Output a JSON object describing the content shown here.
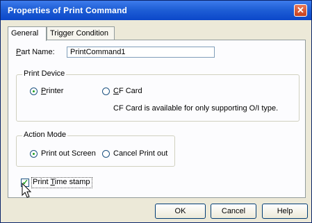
{
  "window": {
    "title": "Properties of Print Command",
    "close_glyph": "✕"
  },
  "tabs": [
    {
      "label": "General",
      "active": true
    },
    {
      "label": "Trigger Condition",
      "active": false
    }
  ],
  "part_name": {
    "label_first": "P",
    "label_rest": "art Name:",
    "value": "PrintCommand1"
  },
  "print_device": {
    "legend": "Print Device",
    "printer": {
      "label_first": "P",
      "label_rest": "rinter",
      "selected": true
    },
    "cf_card": {
      "label_first": "C",
      "label_rest": "F Card",
      "selected": false
    },
    "note": "CF Card is available for only supporting O/I type."
  },
  "action_mode": {
    "legend": "Action Mode",
    "print_out_screen": {
      "label": "Print out Screen",
      "selected": true
    },
    "cancel_print_out": {
      "label": "Cancel Print out",
      "selected": false
    }
  },
  "time_stamp": {
    "label_pre": "Print ",
    "label_first": "T",
    "label_rest": "ime stamp",
    "checked": true,
    "check_glyph": "✓"
  },
  "buttons": {
    "ok": "OK",
    "cancel": "Cancel",
    "help": "Help"
  },
  "colors": {
    "title_bar": "#1f5fd6",
    "dialog_bg": "#ece9d8",
    "panel_bg": "#fcfcfe",
    "radio_dot": "#21a121"
  }
}
